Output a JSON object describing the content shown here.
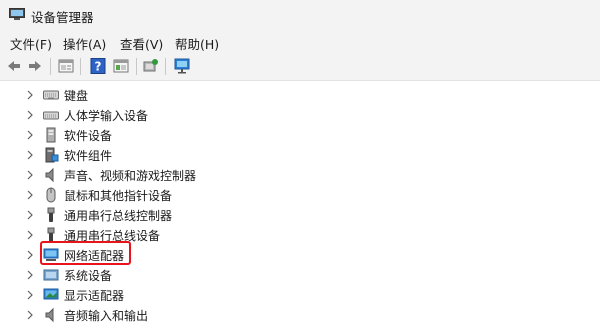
{
  "window": {
    "title": "设备管理器"
  },
  "menu": [
    "文件(F)",
    "操作(A)",
    "查看(V)",
    "帮助(H)"
  ],
  "toolbar": {
    "buttons": [
      "back-icon",
      "forward-icon",
      "properties-icon",
      "help-icon",
      "view-icon",
      "scan-hardware-icon",
      "monitor-icon"
    ]
  },
  "tree": {
    "items": [
      {
        "label": "键盘",
        "icon": "keyboard-icon"
      },
      {
        "label": "人体学输入设备",
        "icon": "hid-icon"
      },
      {
        "label": "软件设备",
        "icon": "software-device-icon"
      },
      {
        "label": "软件组件",
        "icon": "software-component-icon"
      },
      {
        "label": "声音、视频和游戏控制器",
        "icon": "speaker-icon"
      },
      {
        "label": "鼠标和其他指针设备",
        "icon": "mouse-icon"
      },
      {
        "label": "通用串行总线控制器",
        "icon": "usb-icon"
      },
      {
        "label": "通用串行总线设备",
        "icon": "usb-icon"
      },
      {
        "label": "网络适配器",
        "icon": "network-adapter-icon",
        "highlighted": true
      },
      {
        "label": "系统设备",
        "icon": "system-device-icon"
      },
      {
        "label": "显示适配器",
        "icon": "display-adapter-icon"
      },
      {
        "label": "音频输入和输出",
        "icon": "audio-io-icon"
      }
    ]
  },
  "colors": {
    "highlight_border": "#e8141c",
    "chrome_bg": "#f3f3f3"
  }
}
